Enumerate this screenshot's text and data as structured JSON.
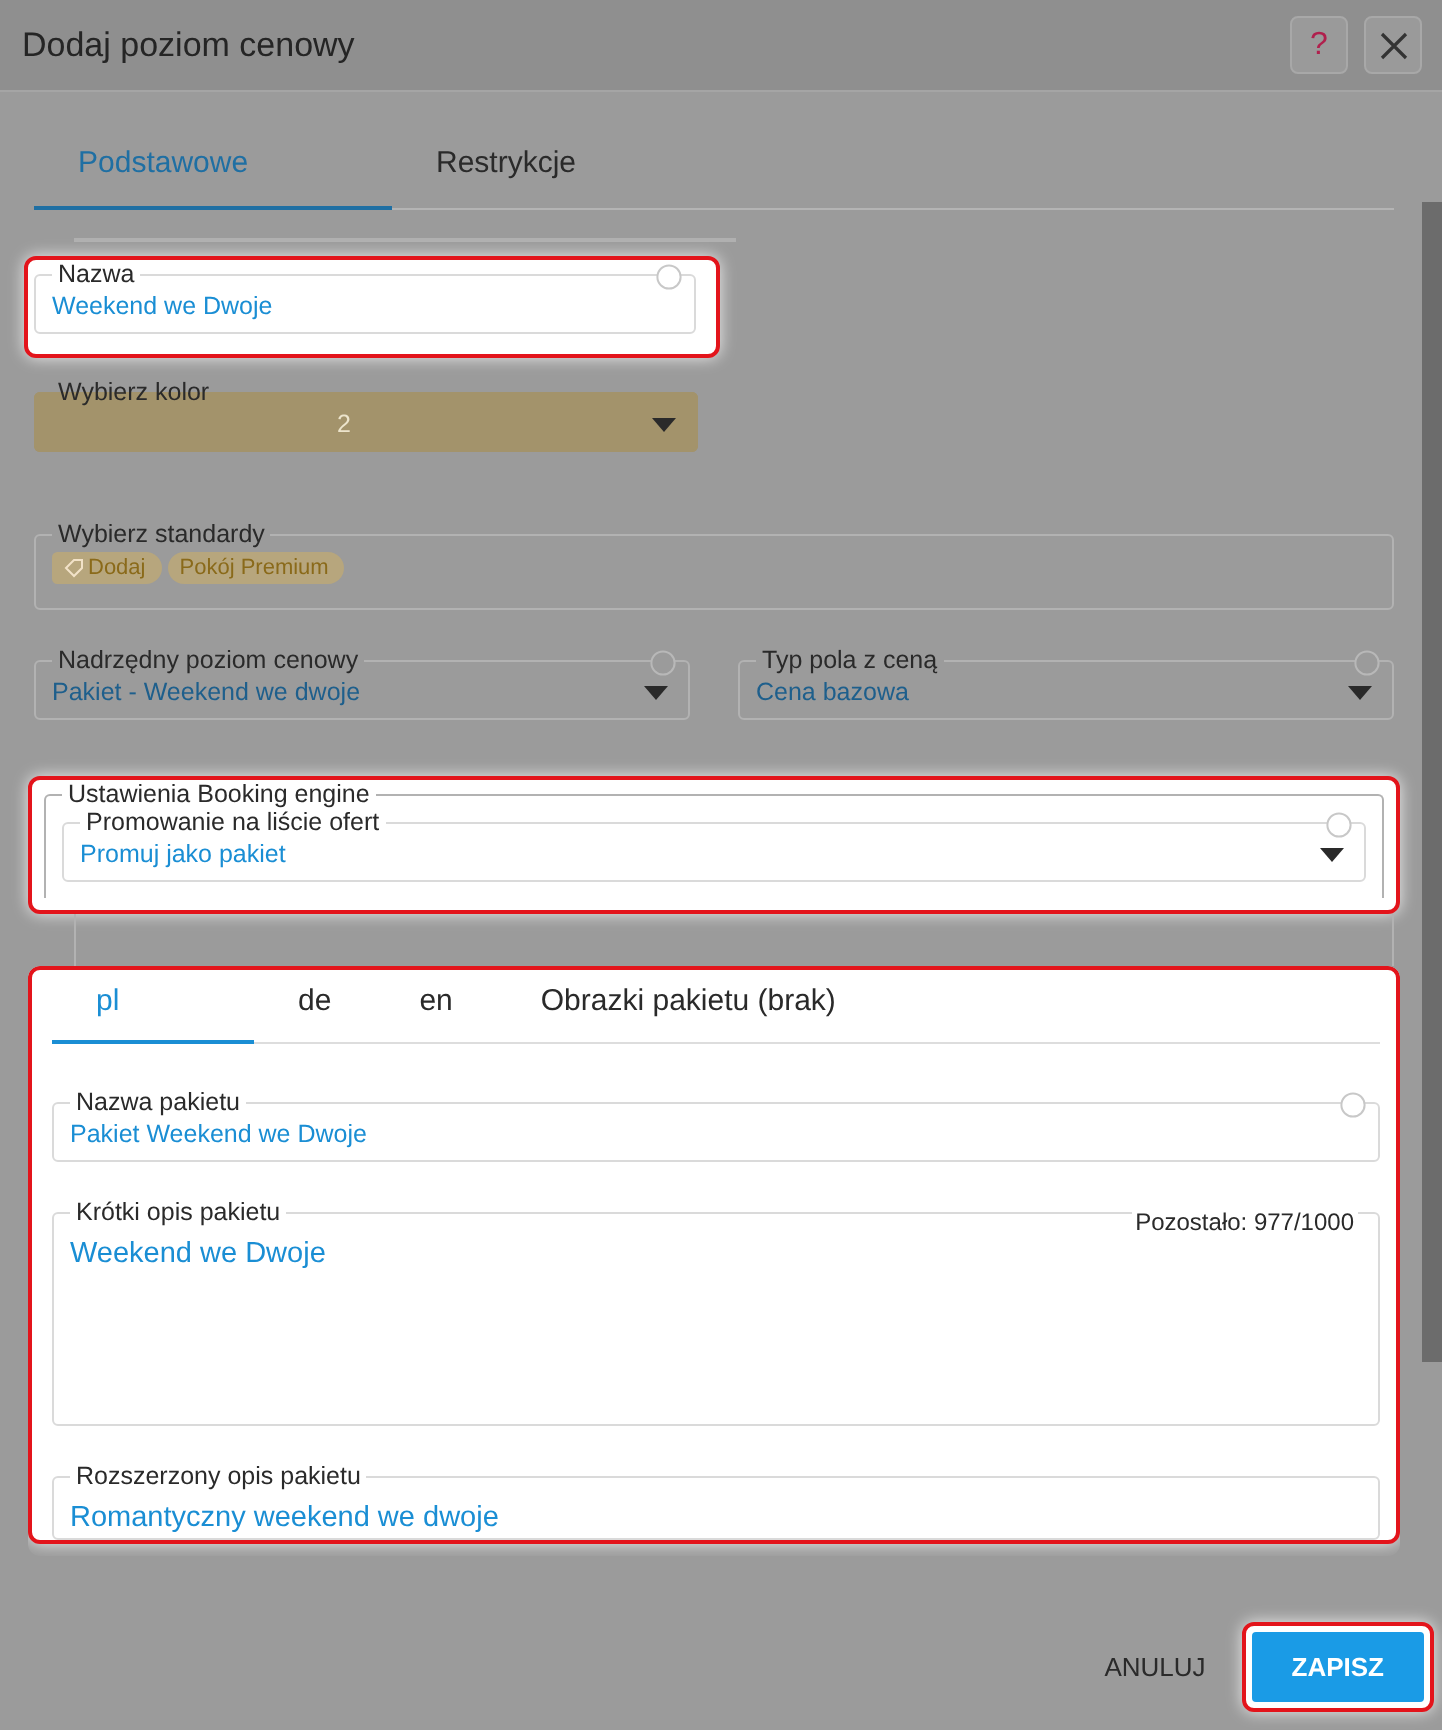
{
  "window": {
    "title": "Dodaj poziom cenowy",
    "buttons": [
      {
        "kind": "help",
        "label": "?"
      },
      {
        "kind": "close"
      }
    ]
  },
  "tabs": [
    {
      "label": "Podstawowe",
      "selected": true
    },
    {
      "label": "Restrykcje",
      "selected": false
    }
  ],
  "name_field": {
    "kind": "input",
    "label": "Nazwa",
    "value": "Weekend we Dwoje",
    "help": true,
    "highlighted": true
  },
  "color_field": {
    "kind": "select",
    "label": "Wybierz kolor",
    "value": "2"
  },
  "standards": {
    "label": "Wybierz standardy",
    "tags": [
      {
        "kind": "add",
        "label": "Dodaj"
      },
      {
        "kind": "tag",
        "label": "Pokój Premium"
      }
    ]
  },
  "selects": [
    {
      "kind": "select",
      "label": "Nadrzędny poziom cenowy",
      "value": "Pakiet - Weekend we dwoje",
      "help": true
    },
    {
      "kind": "select",
      "label": "Typ pola z ceną",
      "value": "Cena bazowa",
      "help": true
    }
  ],
  "booking_engine": {
    "title": "Ustawienia Booking engine",
    "highlighted": true,
    "promotion": {
      "kind": "select",
      "label": "Promowanie na liście ofert",
      "value": "Promuj jako pakiet",
      "help": true
    }
  },
  "package": {
    "highlighted": true,
    "tabs": [
      {
        "label": "pl",
        "selected": true
      },
      {
        "label": "de",
        "selected": false
      },
      {
        "label": "en",
        "selected": false
      },
      {
        "label": "Obrazki pakietu (brak)",
        "selected": false
      }
    ],
    "fields": [
      {
        "kind": "input",
        "label": "Nazwa pakietu",
        "value": "Pakiet Weekend we Dwoje",
        "help": true
      },
      {
        "kind": "textarea",
        "label": "Krótki opis pakietu",
        "counter": "Pozostało: 977/1000",
        "value": "Weekend we Dwoje"
      },
      {
        "kind": "textarea_cut",
        "label": "Rozszerzony opis pakietu",
        "value": "Romantyczny weekend we dwoje"
      }
    ]
  },
  "footer": {
    "cancel": "ANULUJ",
    "save": {
      "label": "ZAPISZ",
      "highlighted": true
    }
  }
}
